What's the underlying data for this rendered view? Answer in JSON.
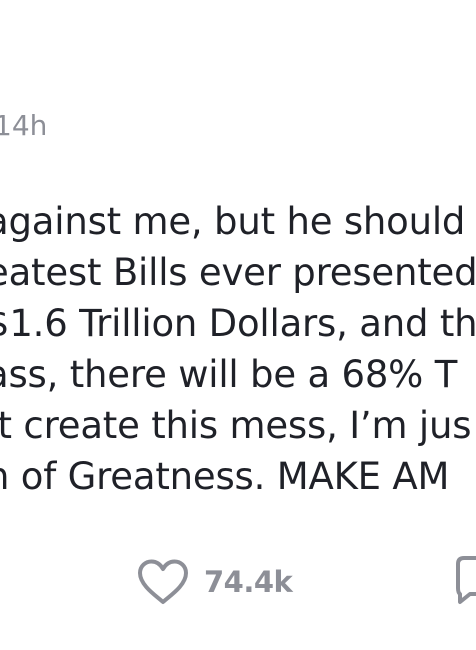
{
  "post": {
    "timestamp": "14h",
    "lines": [
      "against me, but he should",
      "eatest Bills ever presented",
      "$1.6 Trillion Dollars, and th",
      "ass, there will be a 68% T",
      "’t create this mess, I’m jus",
      "h of Greatness. MAKE AM"
    ]
  },
  "actions": {
    "like_count": "74.4k",
    "like_icon": "heart-icon",
    "reply_icon": "comment-icon"
  },
  "colors": {
    "text": "#1f2128",
    "muted": "#8d8f97",
    "background": "#ffffff"
  }
}
